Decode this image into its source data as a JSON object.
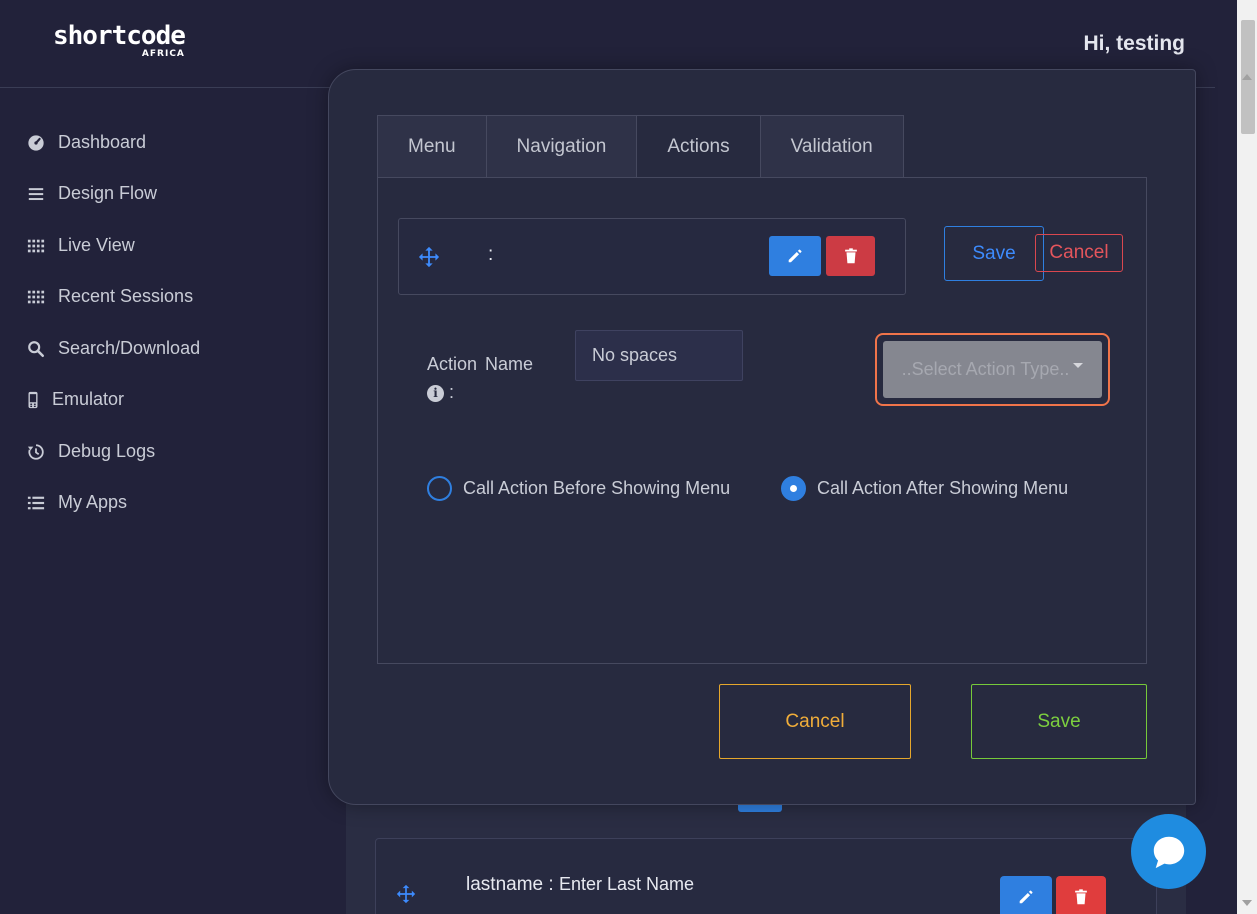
{
  "header": {
    "logo_main": "shortcode",
    "logo_sub": "AFRICA",
    "greeting": "Hi, testing"
  },
  "sidebar": {
    "items": [
      {
        "label": "Dashboard",
        "icon": "dashboard-gauge-icon"
      },
      {
        "label": "Design Flow",
        "icon": "bars-icon"
      },
      {
        "label": "Live View",
        "icon": "grid-dots-icon"
      },
      {
        "label": "Recent Sessions",
        "icon": "grid-dots-icon"
      },
      {
        "label": "Search/Download",
        "icon": "search-icon"
      },
      {
        "label": "Emulator",
        "icon": "mobile-phone-icon"
      },
      {
        "label": "Debug Logs",
        "icon": "history-icon"
      },
      {
        "label": "My Apps",
        "icon": "list-icon"
      }
    ]
  },
  "modal": {
    "tabs": [
      {
        "label": "Menu",
        "active": false
      },
      {
        "label": "Navigation",
        "active": false
      },
      {
        "label": "Actions",
        "active": true
      },
      {
        "label": "Validation",
        "active": false
      }
    ],
    "item": {
      "text": ":"
    },
    "save_small": "Save",
    "cancel_small": "Cancel",
    "action_name": {
      "label_word1": "Action",
      "label_word2": "Name",
      "label_suffix": ":",
      "info_icon": "i",
      "placeholder": "No spaces",
      "value": ""
    },
    "action_type": {
      "placeholder": "..Select Action Type.."
    },
    "radios": [
      {
        "label": "Call Action Before Showing Menu",
        "checked": false
      },
      {
        "label": "Call Action After Showing Menu",
        "checked": true
      }
    ],
    "cancel_big": "Cancel",
    "save_big": "Save"
  },
  "background": {
    "item_key": "lastname",
    "item_sep": " : ",
    "item_value": "Enter Last Name"
  },
  "colors": {
    "primary": "#2f7fe0",
    "danger": "#cc3b44",
    "warning": "#e5a72c",
    "success": "#76c93a",
    "focus_ring": "#f0744a"
  }
}
